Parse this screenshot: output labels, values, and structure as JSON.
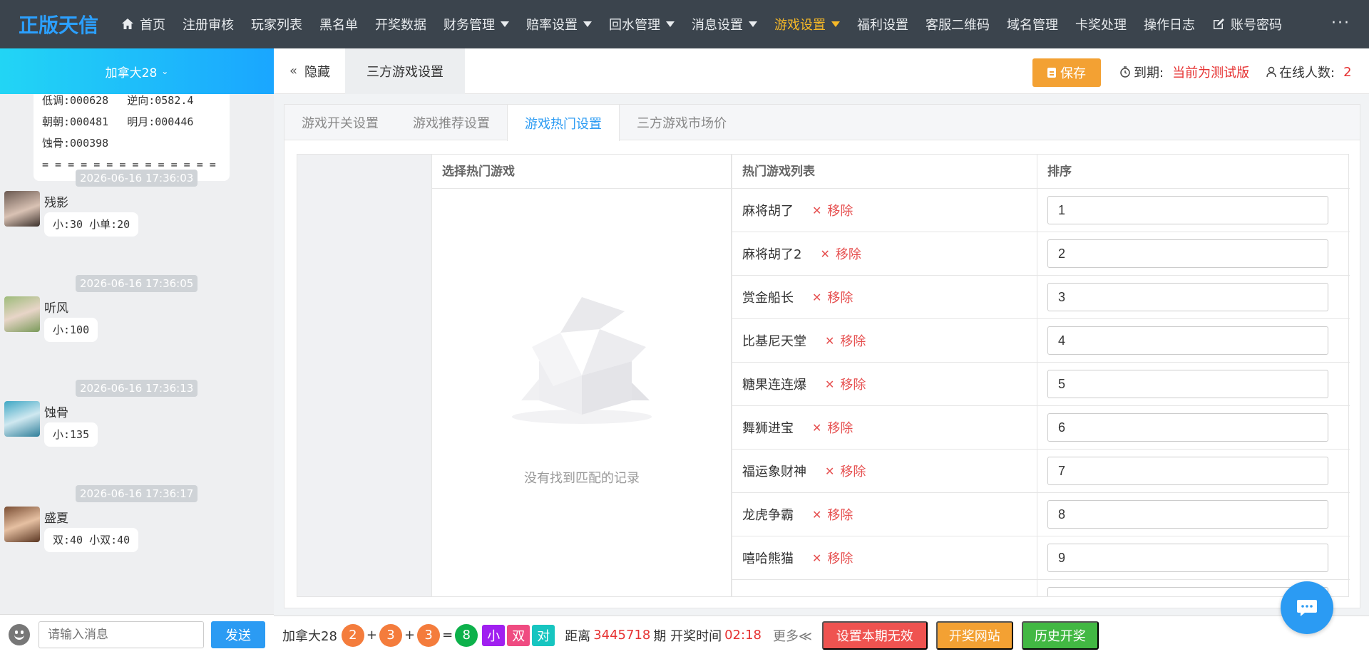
{
  "brand": "正版天信",
  "nav": [
    {
      "label": "首页",
      "icon": "home-icon"
    },
    {
      "label": "注册审核"
    },
    {
      "label": "玩家列表"
    },
    {
      "label": "黑名单"
    },
    {
      "label": "开奖数据"
    },
    {
      "label": "财务管理",
      "dropdown": true
    },
    {
      "label": "赔率设置",
      "dropdown": true
    },
    {
      "label": "回水管理",
      "dropdown": true
    },
    {
      "label": "消息设置",
      "dropdown": true
    },
    {
      "label": "游戏设置",
      "dropdown": true,
      "active": true
    },
    {
      "label": "福利设置"
    },
    {
      "label": "客服二维码"
    },
    {
      "label": "域名管理"
    },
    {
      "label": "卡奖处理"
    },
    {
      "label": "操作日志"
    },
    {
      "label": "账号密码",
      "icon": "edit-icon"
    }
  ],
  "nav_more": "···",
  "chat": {
    "room": "加拿大28",
    "first_lines": [
      [
        "低调:000628",
        "逆向:0582.4"
      ],
      [
        "朝朝:000481",
        "明月:000446"
      ],
      [
        "蚀骨:000398",
        ""
      ]
    ],
    "separator": "= = = = = = = = = = = = = =",
    "messages": [
      {
        "time": "2026-06-16 17:36:03",
        "user": "残影",
        "text": "小:30 小单:20"
      },
      {
        "time": "2026-06-16 17:36:05",
        "user": "听风",
        "text": "小:100"
      },
      {
        "time": "2026-06-16 17:36:13",
        "user": "蚀骨",
        "text": "小:135"
      },
      {
        "time": "2026-06-16 17:36:17",
        "user": "盛夏",
        "text": "双:40 小双:40"
      }
    ],
    "input_placeholder": "请输入消息",
    "send_label": "发送"
  },
  "header": {
    "hide_label": "隐藏",
    "page_tab": "三方游戏设置",
    "save_label": "保存",
    "expire_label": "到期:",
    "expire_value": "当前为测试版",
    "online_label": "在线人数:",
    "online_value": "2"
  },
  "subtabs": [
    "游戏开关设置",
    "游戏推荐设置",
    "游戏热门设置",
    "三方游戏市场价"
  ],
  "active_subtab": "游戏热门设置",
  "select_panel": {
    "title": "选择热门游戏",
    "empty_text": "没有找到匹配的记录"
  },
  "hot_table": {
    "col_game": "热门游戏列表",
    "col_order": "排序",
    "remove_label": "移除",
    "rows": [
      {
        "name": "麻将胡了",
        "order": "1"
      },
      {
        "name": "麻将胡了2",
        "order": "2"
      },
      {
        "name": "赏金船长",
        "order": "3"
      },
      {
        "name": "比基尼天堂",
        "order": "4"
      },
      {
        "name": "糖果连连爆",
        "order": "5"
      },
      {
        "name": "舞狮进宝",
        "order": "6"
      },
      {
        "name": "福运象财神",
        "order": "7"
      },
      {
        "name": "龙虎争霸",
        "order": "8"
      },
      {
        "name": "嘻哈熊猫",
        "order": "9"
      },
      {
        "name": "",
        "order": ""
      }
    ]
  },
  "bottom": {
    "room": "加拿大28",
    "balls": [
      "2",
      "3",
      "3"
    ],
    "plus": "+",
    "eq": "=",
    "sum": "8",
    "tags": [
      "小",
      "双",
      "对"
    ],
    "distance_label": "距离",
    "issue": "3445718",
    "issue_suffix": "期 开奖时间",
    "countdown": "02:18",
    "more": "更多≪",
    "btn_invalid": "设置本期无效",
    "btn_site": "开奖网站",
    "btn_history": "历史开奖"
  },
  "colors": {
    "topnav": "#3b444d",
    "brand": "#2ba0ff",
    "active_nav": "#f7b927",
    "accent": "#2b9bf3",
    "save": "#f3a133",
    "danger": "#ef5350",
    "success": "#42b843"
  }
}
